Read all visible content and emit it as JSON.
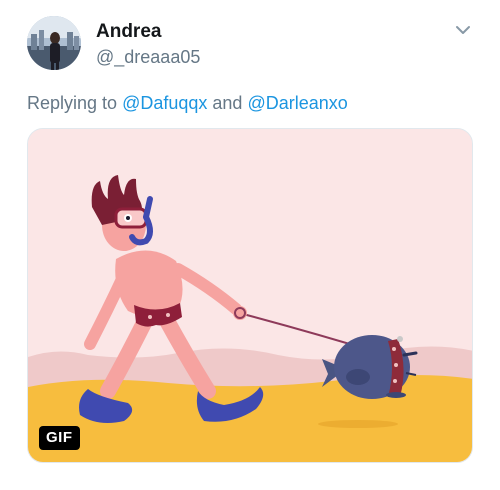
{
  "tweet": {
    "author": {
      "display_name": "Andrea",
      "handle": "@_dreaaa05",
      "avatar_icon": "profile-photo"
    },
    "menu_icon": "chevron-down-icon",
    "reply": {
      "prefix": "Replying to ",
      "mentions": [
        "@Dafuqqx",
        "@Darleanxo"
      ],
      "conjunction": " and "
    },
    "media": {
      "type": "gif",
      "badge": "GIF",
      "illustration": "snorkeler walking a fish on a leash"
    }
  },
  "colors": {
    "accent": "#1b95e0",
    "secondary_text": "#657786",
    "primary_text": "#14171a",
    "gif_background": "#fbe6e6",
    "sand": "#f7bd3e"
  }
}
